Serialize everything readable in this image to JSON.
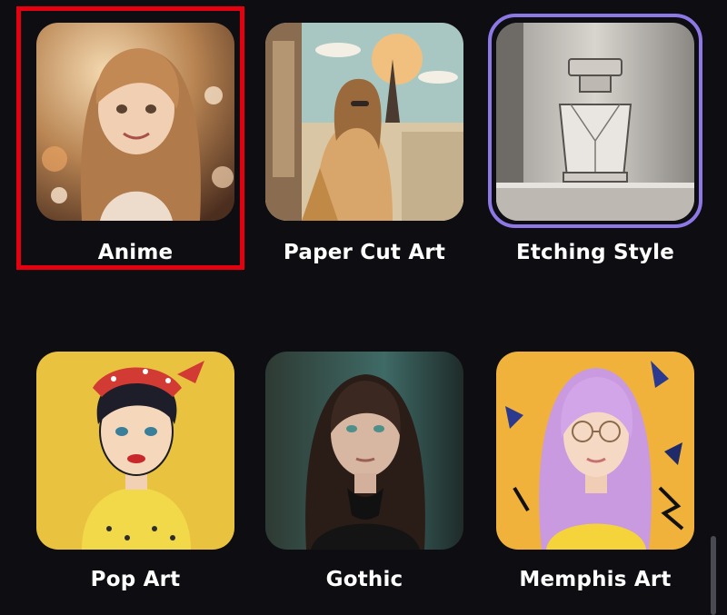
{
  "styles": [
    {
      "id": "anime",
      "label": "Anime",
      "highlighted": true,
      "selected": false
    },
    {
      "id": "paper-cut-art",
      "label": "Paper Cut Art",
      "highlighted": false,
      "selected": false
    },
    {
      "id": "etching-style",
      "label": "Etching Style",
      "highlighted": false,
      "selected": true
    },
    {
      "id": "pop-art",
      "label": "Pop Art",
      "highlighted": false,
      "selected": false
    },
    {
      "id": "gothic",
      "label": "Gothic",
      "highlighted": false,
      "selected": false
    },
    {
      "id": "memphis-art",
      "label": "Memphis Art",
      "highlighted": false,
      "selected": false
    }
  ],
  "colors": {
    "background": "#0d0d12",
    "highlight": "#e4000f",
    "selected_ring": "#8e78e6",
    "label_text": "#ffffff"
  }
}
